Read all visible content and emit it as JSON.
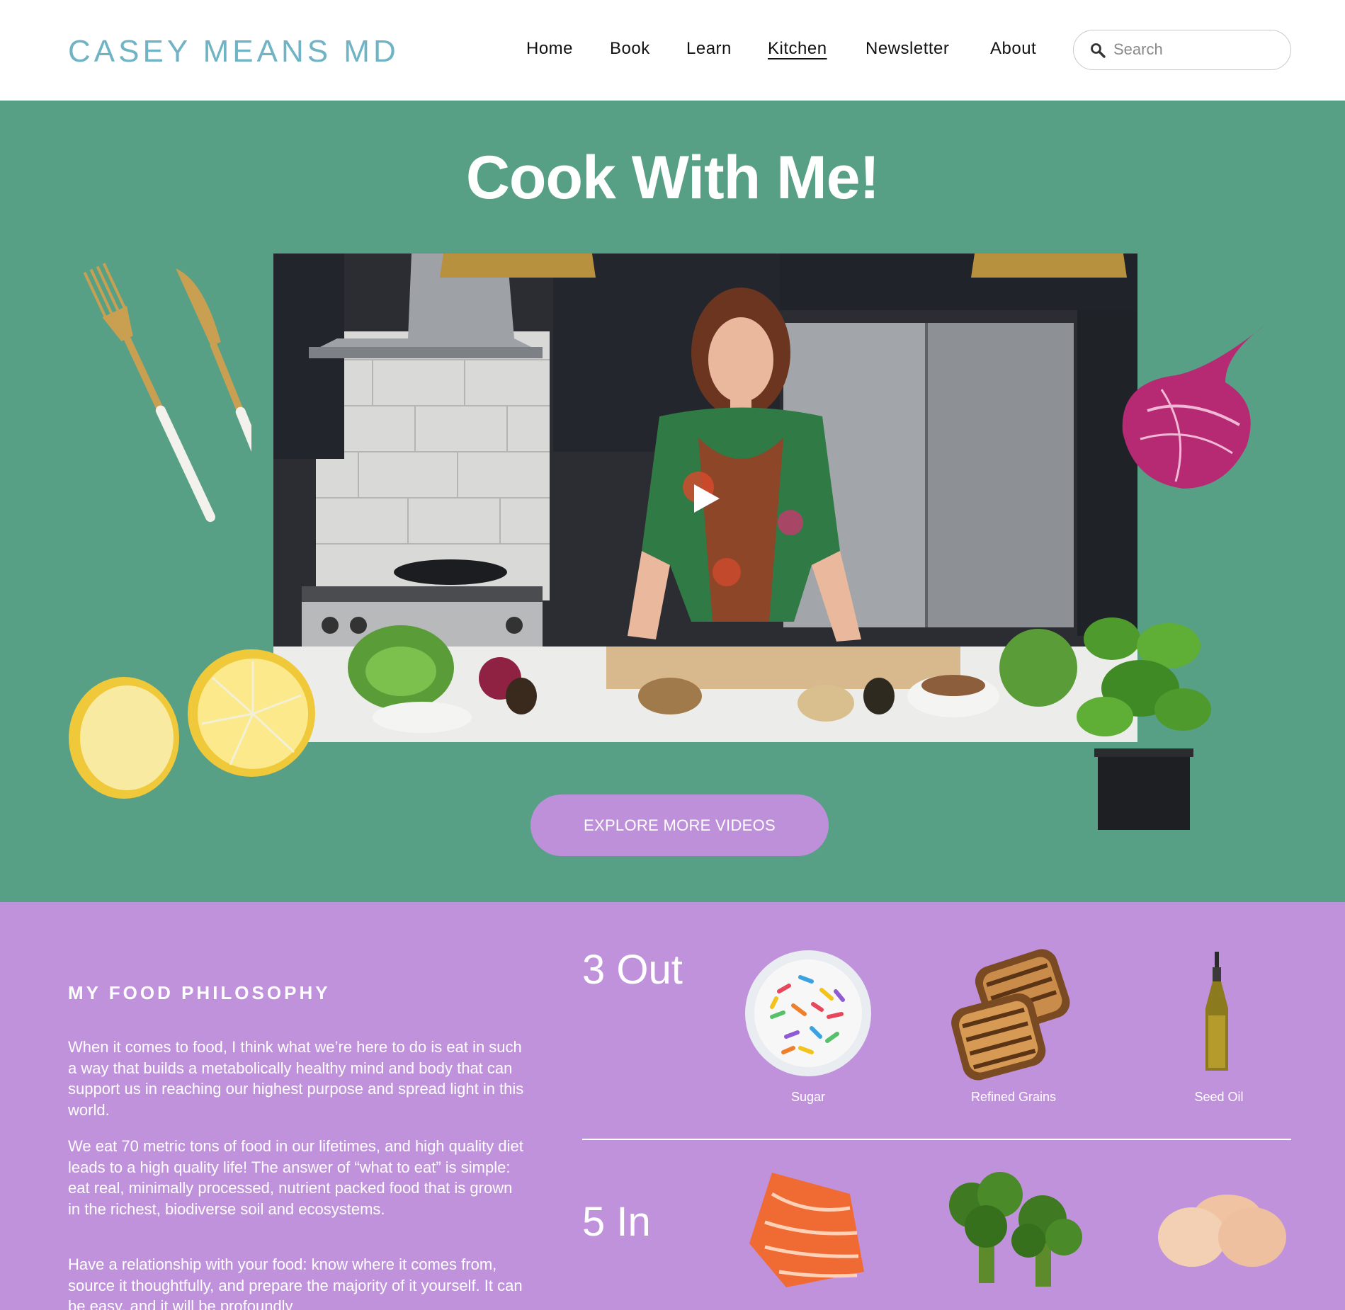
{
  "header": {
    "logo": "CASEY MEANS MD",
    "nav": [
      "Home",
      "Book",
      "Learn",
      "Kitchen",
      "Newsletter",
      "About"
    ],
    "active_nav": "Kitchen",
    "search_placeholder": "Search"
  },
  "hero": {
    "title": "Cook With Me!",
    "cta_label": "EXPLORE MORE VIDEOS",
    "video_icon": "play-icon"
  },
  "philosophy": {
    "heading": "MY FOOD PHILOSOPHY",
    "paragraphs": [
      "When it comes to food, I think what we’re here to do is eat in such a way that builds a metabolically healthy mind and body that can support us in reaching our highest purpose and spread light in this world.",
      "We eat 70 metric tons of food in our lifetimes, and high quality diet leads to a high quality life! The answer of “what to eat” is simple: eat real, minimally processed, nutrient packed food that is grown in the richest, biodiverse soil and ecosystems.",
      "Have a relationship with your food: know where it comes from, source it thoughtfully, and prepare the majority of it yourself. It can be easy, and it will be profoundly"
    ],
    "out": {
      "label": "3 Out",
      "items": [
        "Sugar",
        "Refined Grains",
        "Seed Oil"
      ]
    },
    "in": {
      "label": "5 In"
    }
  },
  "colors": {
    "logo": "#6fb3c4",
    "hero_bg": "#57a086",
    "philosophy_bg": "#c092db",
    "cta_bg": "#be90da"
  }
}
